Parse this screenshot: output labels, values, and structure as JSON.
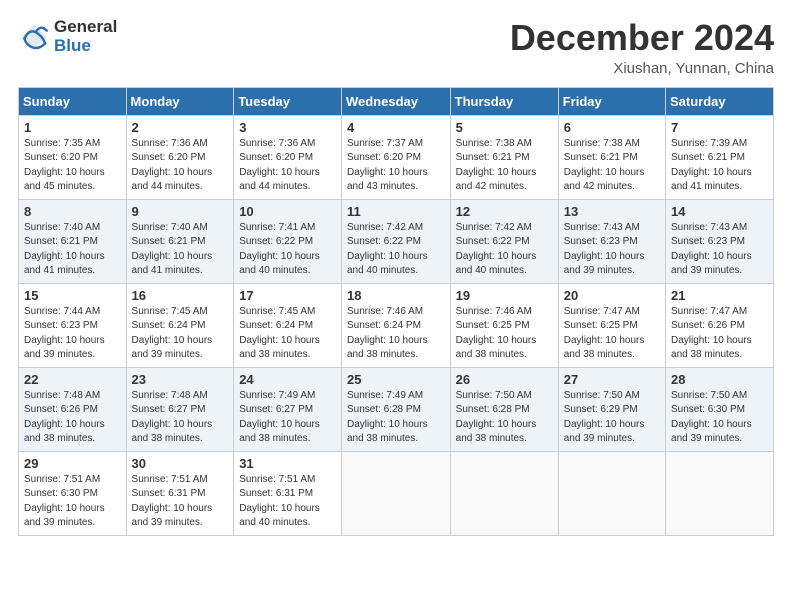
{
  "header": {
    "logo_general": "General",
    "logo_blue": "Blue",
    "month_title": "December 2024",
    "location": "Xiushan, Yunnan, China"
  },
  "calendar": {
    "days_of_week": [
      "Sunday",
      "Monday",
      "Tuesday",
      "Wednesday",
      "Thursday",
      "Friday",
      "Saturday"
    ],
    "weeks": [
      [
        null,
        {
          "day": "2",
          "sunrise": "7:36 AM",
          "sunset": "6:20 PM",
          "daylight": "10 hours and 44 minutes."
        },
        {
          "day": "3",
          "sunrise": "7:36 AM",
          "sunset": "6:20 PM",
          "daylight": "10 hours and 44 minutes."
        },
        {
          "day": "4",
          "sunrise": "7:37 AM",
          "sunset": "6:20 PM",
          "daylight": "10 hours and 43 minutes."
        },
        {
          "day": "5",
          "sunrise": "7:38 AM",
          "sunset": "6:21 PM",
          "daylight": "10 hours and 42 minutes."
        },
        {
          "day": "6",
          "sunrise": "7:38 AM",
          "sunset": "6:21 PM",
          "daylight": "10 hours and 42 minutes."
        },
        {
          "day": "7",
          "sunrise": "7:39 AM",
          "sunset": "6:21 PM",
          "daylight": "10 hours and 41 minutes."
        }
      ],
      [
        {
          "day": "1",
          "sunrise": "7:35 AM",
          "sunset": "6:20 PM",
          "daylight": "10 hours and 45 minutes."
        },
        {
          "day": "9",
          "sunrise": "7:40 AM",
          "sunset": "6:21 PM",
          "daylight": "10 hours and 41 minutes."
        },
        {
          "day": "10",
          "sunrise": "7:41 AM",
          "sunset": "6:22 PM",
          "daylight": "10 hours and 40 minutes."
        },
        {
          "day": "11",
          "sunrise": "7:42 AM",
          "sunset": "6:22 PM",
          "daylight": "10 hours and 40 minutes."
        },
        {
          "day": "12",
          "sunrise": "7:42 AM",
          "sunset": "6:22 PM",
          "daylight": "10 hours and 40 minutes."
        },
        {
          "day": "13",
          "sunrise": "7:43 AM",
          "sunset": "6:23 PM",
          "daylight": "10 hours and 39 minutes."
        },
        {
          "day": "14",
          "sunrise": "7:43 AM",
          "sunset": "6:23 PM",
          "daylight": "10 hours and 39 minutes."
        }
      ],
      [
        {
          "day": "8",
          "sunrise": "7:40 AM",
          "sunset": "6:21 PM",
          "daylight": "10 hours and 41 minutes."
        },
        {
          "day": "16",
          "sunrise": "7:45 AM",
          "sunset": "6:24 PM",
          "daylight": "10 hours and 39 minutes."
        },
        {
          "day": "17",
          "sunrise": "7:45 AM",
          "sunset": "6:24 PM",
          "daylight": "10 hours and 38 minutes."
        },
        {
          "day": "18",
          "sunrise": "7:46 AM",
          "sunset": "6:24 PM",
          "daylight": "10 hours and 38 minutes."
        },
        {
          "day": "19",
          "sunrise": "7:46 AM",
          "sunset": "6:25 PM",
          "daylight": "10 hours and 38 minutes."
        },
        {
          "day": "20",
          "sunrise": "7:47 AM",
          "sunset": "6:25 PM",
          "daylight": "10 hours and 38 minutes."
        },
        {
          "day": "21",
          "sunrise": "7:47 AM",
          "sunset": "6:26 PM",
          "daylight": "10 hours and 38 minutes."
        }
      ],
      [
        {
          "day": "15",
          "sunrise": "7:44 AM",
          "sunset": "6:23 PM",
          "daylight": "10 hours and 39 minutes."
        },
        {
          "day": "23",
          "sunrise": "7:48 AM",
          "sunset": "6:27 PM",
          "daylight": "10 hours and 38 minutes."
        },
        {
          "day": "24",
          "sunrise": "7:49 AM",
          "sunset": "6:27 PM",
          "daylight": "10 hours and 38 minutes."
        },
        {
          "day": "25",
          "sunrise": "7:49 AM",
          "sunset": "6:28 PM",
          "daylight": "10 hours and 38 minutes."
        },
        {
          "day": "26",
          "sunrise": "7:50 AM",
          "sunset": "6:28 PM",
          "daylight": "10 hours and 38 minutes."
        },
        {
          "day": "27",
          "sunrise": "7:50 AM",
          "sunset": "6:29 PM",
          "daylight": "10 hours and 39 minutes."
        },
        {
          "day": "28",
          "sunrise": "7:50 AM",
          "sunset": "6:30 PM",
          "daylight": "10 hours and 39 minutes."
        }
      ],
      [
        {
          "day": "22",
          "sunrise": "7:48 AM",
          "sunset": "6:26 PM",
          "daylight": "10 hours and 38 minutes."
        },
        {
          "day": "30",
          "sunrise": "7:51 AM",
          "sunset": "6:31 PM",
          "daylight": "10 hours and 39 minutes."
        },
        {
          "day": "31",
          "sunrise": "7:51 AM",
          "sunset": "6:31 PM",
          "daylight": "10 hours and 40 minutes."
        },
        null,
        null,
        null,
        null
      ],
      [
        {
          "day": "29",
          "sunrise": "7:51 AM",
          "sunset": "6:30 PM",
          "daylight": "10 hours and 39 minutes."
        },
        null,
        null,
        null,
        null,
        null,
        null
      ]
    ],
    "labels": {
      "sunrise": "Sunrise:",
      "sunset": "Sunset:",
      "daylight": "Daylight:"
    }
  }
}
